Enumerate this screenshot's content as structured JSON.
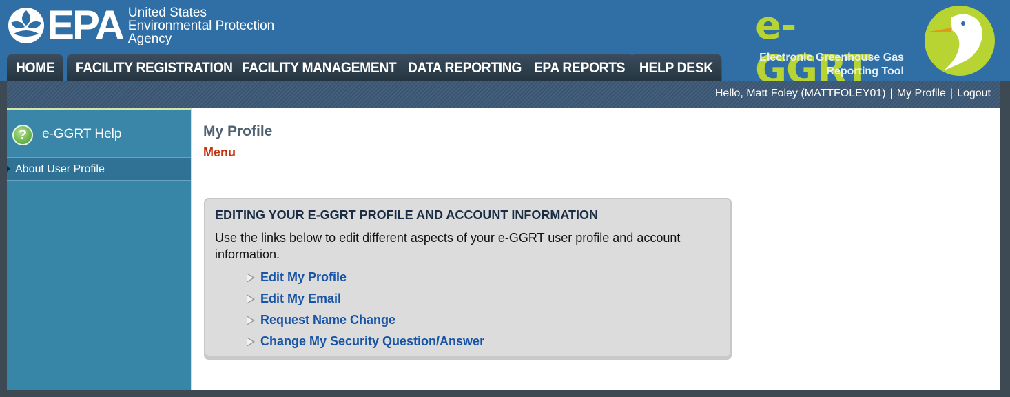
{
  "header": {
    "epa": {
      "abbr": "EPA",
      "line1": "United States",
      "line2": "Environmental Protection",
      "line3": "Agency",
      "mark_icon": "epa-flower-icon"
    },
    "eggrt": {
      "title": "e-GGRT",
      "sub1": "Electronic Greenhouse Gas",
      "sub2": "Reporting Tool",
      "bird_icon": "egret-icon"
    }
  },
  "nav": {
    "tabs": [
      {
        "label": "HOME"
      },
      {
        "label": "FACILITY REGISTRATION"
      },
      {
        "label": "FACILITY MANAGEMENT"
      },
      {
        "label": "DATA REPORTING"
      },
      {
        "label": "EPA REPORTS"
      },
      {
        "label": "HELP DESK"
      }
    ]
  },
  "userbar": {
    "greeting": "Hello, Matt Foley (MATTFOLEY01)",
    "separator": "|",
    "profile": "My Profile",
    "logout": "Logout"
  },
  "sidebar": {
    "help_title": "e-GGRT Help",
    "help_icon_glyph": "?",
    "items": [
      {
        "label": "About User Profile"
      }
    ]
  },
  "main": {
    "title": "My Profile",
    "menu": "Menu",
    "panel": {
      "title": "EDITING YOUR E-GGRT PROFILE AND ACCOUNT INFORMATION",
      "description": "Use the links below to edit different aspects of your e-GGRT user profile and account information.",
      "links": [
        {
          "label": "Edit My Profile"
        },
        {
          "label": "Edit My Email"
        },
        {
          "label": "Request Name Change"
        },
        {
          "label": "Change My Security Question/Answer"
        }
      ]
    }
  },
  "colors": {
    "header_blue": "#2f6fa6",
    "sidebar_teal": "#3786a7",
    "link_blue": "#1754a6",
    "menu_red": "#c0330f",
    "eggrt_green": "#b8d432"
  }
}
